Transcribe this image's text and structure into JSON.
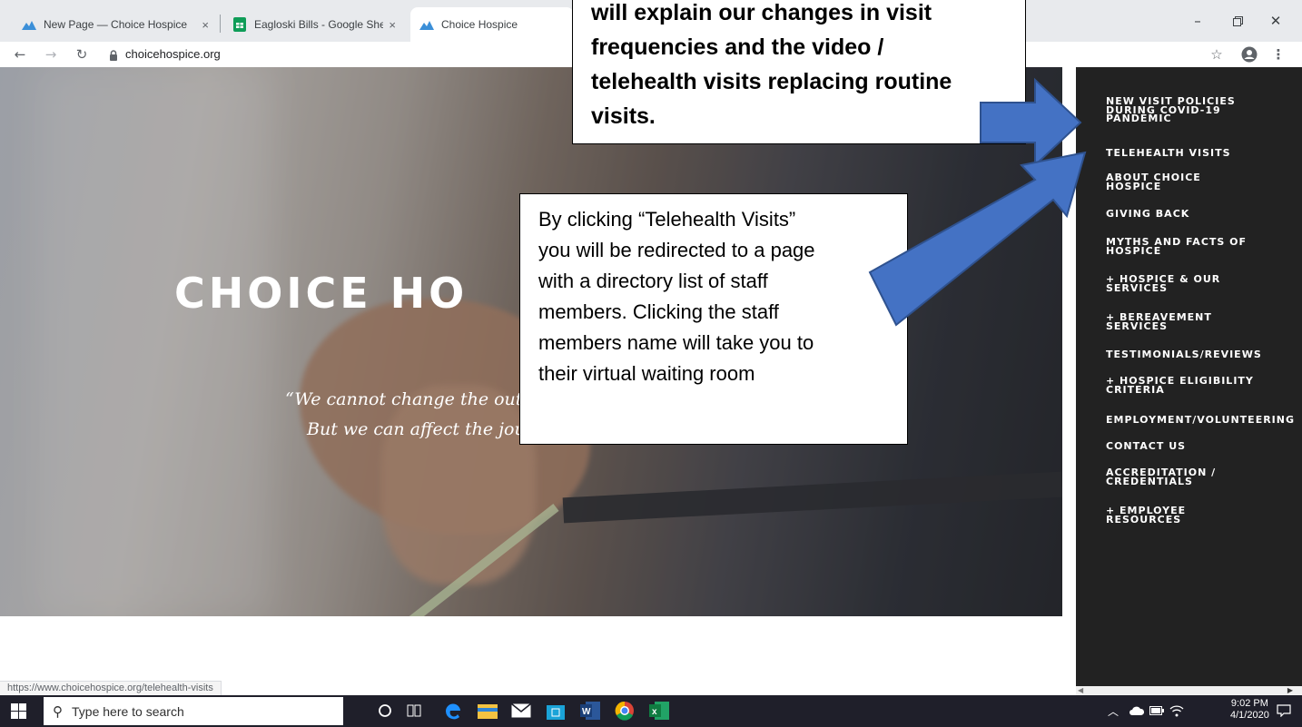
{
  "browser": {
    "tabs": [
      {
        "title": "New Page — Choice Hospice",
        "favicon": "choice-hospice-logo-icon",
        "active": false
      },
      {
        "title": "Eagloski Bills - Google Sheets",
        "favicon": "google-sheets-icon",
        "active": false
      },
      {
        "title": "Choice Hospice",
        "favicon": "choice-hospice-logo-icon",
        "active": true
      }
    ],
    "tab_close_glyph": "×",
    "url": "choicehospice.org",
    "status_url": "https://www.choicehospice.org/telehealth-visits"
  },
  "hero": {
    "title": "CHOICE HO",
    "quote_line1": "“We cannot change the outc",
    "quote_line2": "But we can affect the jour"
  },
  "sidebar": {
    "items": [
      {
        "label": "NEW VISIT POLICIES\nDURING COVID-19\nPANDEMIC"
      },
      {
        "label": "TELEHEALTH VISITS"
      },
      {
        "label": "ABOUT CHOICE\nHOSPICE"
      },
      {
        "label": "GIVING BACK"
      },
      {
        "label": "MYTHS AND FACTS OF\nHOSPICE"
      },
      {
        "label": "+ HOSPICE & OUR\nSERVICES"
      },
      {
        "label": "+ BEREAVEMENT\nSERVICES"
      },
      {
        "label": "TESTIMONIALS/REVIEWS"
      },
      {
        "label": "+ HOSPICE ELIGIBILITY\nCRITERIA"
      },
      {
        "label": "EMPLOYMENT/VOLUNTEERING"
      },
      {
        "label": "CONTACT US"
      },
      {
        "label": "ACCREDITATION /\nCREDENTIALS"
      },
      {
        "label": "+ EMPLOYEE\nRESOURCES"
      }
    ]
  },
  "callouts": {
    "top_lines": [
      "will explain our changes in visit",
      "frequencies and the video /",
      "telehealth visits replacing routine",
      "visits."
    ],
    "mid_lines": [
      "By clicking “Telehealth Visits”",
      "you will be redirected to a page",
      "with a directory list of staff",
      "members. Clicking the staff",
      "members name will take you to",
      "their virtual waiting room"
    ]
  },
  "taskbar": {
    "search_placeholder": "Type here to search",
    "time": "9:02 PM",
    "date": "4/1/2020"
  }
}
